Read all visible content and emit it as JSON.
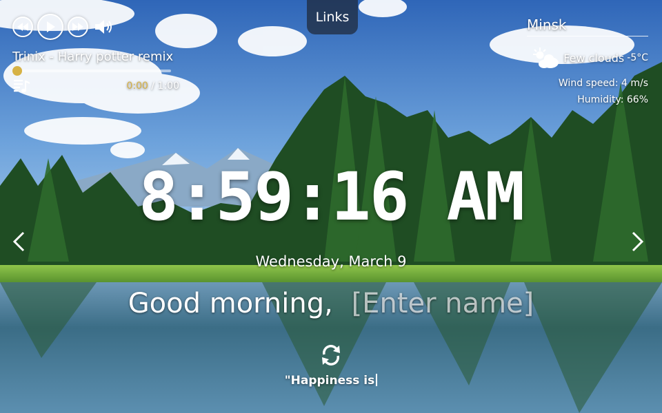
{
  "player": {
    "track_title": "Trinix - Harry potter remix",
    "current_time": "0:00",
    "separator": "/",
    "total_time": "1:00",
    "progress": 0
  },
  "links": {
    "label": "Links"
  },
  "weather": {
    "city": "Minsk",
    "condition": "Few clouds",
    "temperature": "-5°C",
    "wind": "Wind speed: 4 m/s",
    "humidity": "Humidity: 66%"
  },
  "clock": {
    "time": "8:59:16 AM"
  },
  "date": {
    "text": "Wednesday, March 9"
  },
  "greeting": {
    "text": "Good morning,",
    "name_placeholder": "[Enter name]"
  },
  "quote": {
    "text": "\"Happiness is"
  },
  "colors": {
    "accent": "#d6b245",
    "links_bg": "#1e2837"
  },
  "icons": [
    "previous-icon",
    "play-icon",
    "next-icon",
    "volume-icon",
    "playlist-icon",
    "weather-cloud-icon",
    "chevron-left-icon",
    "chevron-right-icon",
    "refresh-icon"
  ]
}
